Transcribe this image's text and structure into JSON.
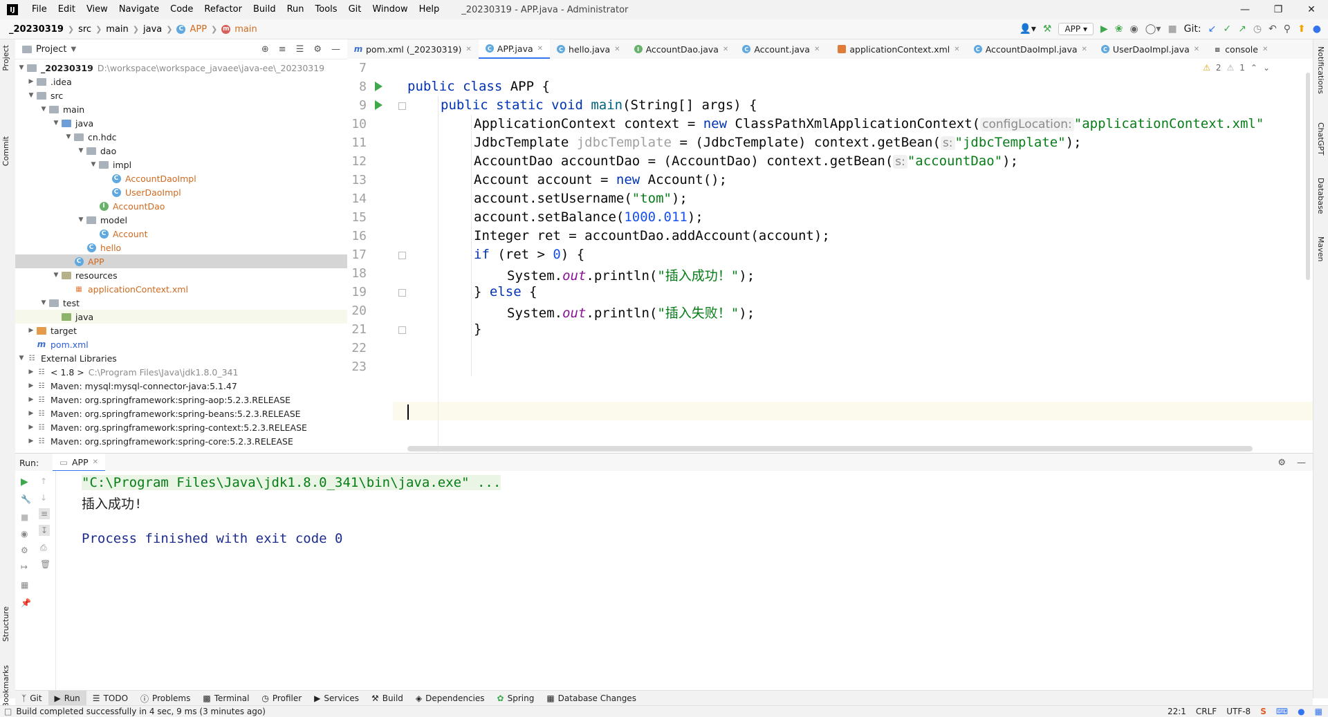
{
  "window": {
    "title": "_20230319 - APP.java - Administrator",
    "logo": "IJ",
    "menu": [
      "File",
      "Edit",
      "View",
      "Navigate",
      "Code",
      "Refactor",
      "Build",
      "Run",
      "Tools",
      "Git",
      "Window",
      "Help"
    ],
    "controls": [
      "minimize-icon",
      "restore-icon",
      "close-icon"
    ]
  },
  "breadcrumb": [
    "_20230319",
    "src",
    "main",
    "java",
    "APP",
    "main"
  ],
  "toolbar": {
    "run_config": "APP",
    "git_label": "Git:"
  },
  "project": {
    "header": "Project",
    "tree": [
      {
        "label": "_20230319",
        "extra": "D:\\workspace\\workspace_javaee\\java-ee\\_20230319"
      },
      {
        "label": ".idea"
      },
      {
        "label": "src"
      },
      {
        "label": "main"
      },
      {
        "label": "java"
      },
      {
        "label": "cn.hdc"
      },
      {
        "label": "dao"
      },
      {
        "label": "impl"
      },
      {
        "label": "AccountDaoImpl"
      },
      {
        "label": "UserDaoImpl"
      },
      {
        "label": "AccountDao"
      },
      {
        "label": "model"
      },
      {
        "label": "Account"
      },
      {
        "label": "hello"
      },
      {
        "label": "APP"
      },
      {
        "label": "resources"
      },
      {
        "label": "applicationContext.xml"
      },
      {
        "label": "test"
      },
      {
        "label": "java"
      },
      {
        "label": "target"
      },
      {
        "label": "pom.xml"
      },
      {
        "label": "External Libraries"
      },
      {
        "label": "< 1.8 >",
        "extra": "C:\\Program Files\\Java\\jdk1.8.0_341"
      },
      {
        "label": "Maven: mysql:mysql-connector-java:5.1.47"
      },
      {
        "label": "Maven: org.springframework:spring-aop:5.2.3.RELEASE"
      },
      {
        "label": "Maven: org.springframework:spring-beans:5.2.3.RELEASE"
      },
      {
        "label": "Maven: org.springframework:spring-context:5.2.3.RELEASE"
      },
      {
        "label": "Maven: org.springframework:spring-core:5.2.3.RELEASE"
      }
    ]
  },
  "editor": {
    "tabs": [
      "pom.xml (_20230319)",
      "APP.java",
      "hello.java",
      "AccountDao.java",
      "Account.java",
      "applicationContext.xml",
      "AccountDaoImpl.java",
      "UserDaoImpl.java",
      "console"
    ],
    "active_tab": "APP.java",
    "warnings": "2",
    "weak_warnings": "1",
    "line_numbers": [
      "7",
      "8",
      "9",
      "10",
      "11",
      "12",
      "13",
      "14",
      "15",
      "16",
      "17",
      "18",
      "19",
      "20",
      "21",
      "22",
      "23"
    ]
  },
  "code": {
    "l8_kw": "public class ",
    "l8_rest": "APP {",
    "l9_kw": "public static void ",
    "l9_fn": "main",
    "l9_rest": "(String[] args) {",
    "l10_a": "ApplicationContext context = ",
    "l10_new": "new ",
    "l10_b": "ClassPathXmlApplicationContext(",
    "l10_hint": "configLocation:",
    "l10_str": "\"applicationContext.xml\"",
    "l11_a": "JdbcTemplate ",
    "l11_var": "jdbcTemplate",
    "l11_b": " = (JdbcTemplate) context.getBean(",
    "l11_hint": "s:",
    "l11_str": "\"jdbcTemplate\"",
    "l11_c": ");",
    "l12_a": "AccountDao accountDao = (AccountDao) context.getBean(",
    "l12_hint": "s:",
    "l12_str": "\"accountDao\"",
    "l12_c": ");",
    "l13_a": "Account account = ",
    "l13_new": "new ",
    "l13_b": "Account();",
    "l14_a": "account.setUsername(",
    "l14_str": "\"tom\"",
    "l14_b": ");",
    "l15_a": "account.setBalance(",
    "l15_num": "1000.011",
    "l15_b": ");",
    "l16": "Integer ret = accountDao.addAccount(account);",
    "l17_if": "if ",
    "l17_a": "(ret > ",
    "l17_num": "0",
    "l17_b": ") {",
    "l18_a": "System.",
    "l18_out": "out",
    "l18_b": ".println(",
    "l18_str": "\"插入成功！\"",
    "l18_c": ");",
    "l19_a": "} ",
    "l19_else": "else ",
    "l19_b": "{",
    "l20_a": "System.",
    "l20_out": "out",
    "l20_b": ".println(",
    "l20_str": "\"插入失败！\"",
    "l20_c": ");",
    "l21": "}"
  },
  "run": {
    "label": "Run:",
    "tab": "APP",
    "cmd": "\"C:\\Program Files\\Java\\jdk1.8.0_341\\bin\\java.exe\" ...",
    "output": "插入成功!",
    "exit": "Process finished with exit code 0"
  },
  "tool_windows": [
    "Git",
    "Run",
    "TODO",
    "Problems",
    "Terminal",
    "Profiler",
    "Services",
    "Build",
    "Dependencies",
    "Spring",
    "Database Changes"
  ],
  "side_tabs_left": [
    "Project",
    "Commit",
    "Structure",
    "Bookmarks"
  ],
  "side_tabs_right": [
    "Notifications",
    "ChatGPT",
    "Database",
    "Maven"
  ],
  "status": {
    "message": "Build completed successfully in 4 sec, 9 ms (3 minutes ago)",
    "position": "22:1",
    "line_sep": "CRLF",
    "encoding": "UTF-8"
  }
}
